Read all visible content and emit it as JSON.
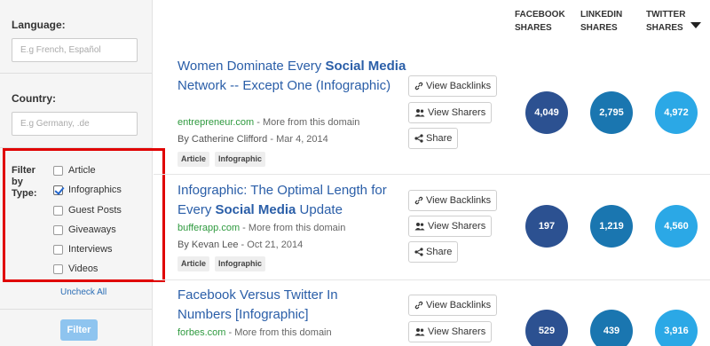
{
  "filters": {
    "language_label": "Language:",
    "language_placeholder": "E.g French, Español",
    "country_label": "Country:",
    "country_placeholder": "E.g Germany, .de",
    "type_label": "Filter by Type:",
    "types": [
      {
        "label": "Article",
        "checked": false
      },
      {
        "label": "Infographics",
        "checked": true
      },
      {
        "label": "Guest Posts",
        "checked": false
      },
      {
        "label": "Giveaways",
        "checked": false
      },
      {
        "label": "Interviews",
        "checked": false
      },
      {
        "label": "Videos",
        "checked": false
      }
    ],
    "uncheck_all": "Uncheck All",
    "filter_button": "Filter"
  },
  "columns": {
    "facebook": "FACEBOOK SHARES",
    "linkedin": "LINKEDIN SHARES",
    "twitter": "TWITTER SHARES"
  },
  "actions": {
    "backlinks": "View Backlinks",
    "sharers": "View Sharers",
    "share": "Share"
  },
  "colors": {
    "facebook": "#2c5191",
    "linkedin": "#1a76b0",
    "twitter": "#2ba8e6",
    "highlight": "#e00000"
  },
  "results": [
    {
      "title_pre": "Women Dominate Every ",
      "title_bold": "Social Media",
      "title_post": " Network -- Except One (Infographic)",
      "domain": "entrepreneur.com",
      "more": " - More from this domain",
      "author": "By Catherine Clifford",
      "date": " - Mar 4, 2014",
      "tags": [
        "Article",
        "Infographic"
      ],
      "facebook": "4,049",
      "linkedin": "2,795",
      "twitter": "4,972"
    },
    {
      "title_pre": "Infographic: The Optimal Length for Every ",
      "title_bold": "Social Media",
      "title_post": " Update",
      "domain": "bufferapp.com",
      "more": " - More from this domain",
      "author": "By Kevan Lee",
      "date": " - Oct 21, 2014",
      "tags": [
        "Article",
        "Infographic"
      ],
      "facebook": "197",
      "linkedin": "1,219",
      "twitter": "4,560"
    },
    {
      "title_pre": "Facebook Versus Twitter In Numbers [Infographic]",
      "title_bold": "",
      "title_post": "",
      "domain": "forbes.com",
      "more": " - More from this domain",
      "author": "",
      "date": "",
      "tags": [],
      "facebook": "529",
      "linkedin": "439",
      "twitter": "3,916"
    }
  ]
}
